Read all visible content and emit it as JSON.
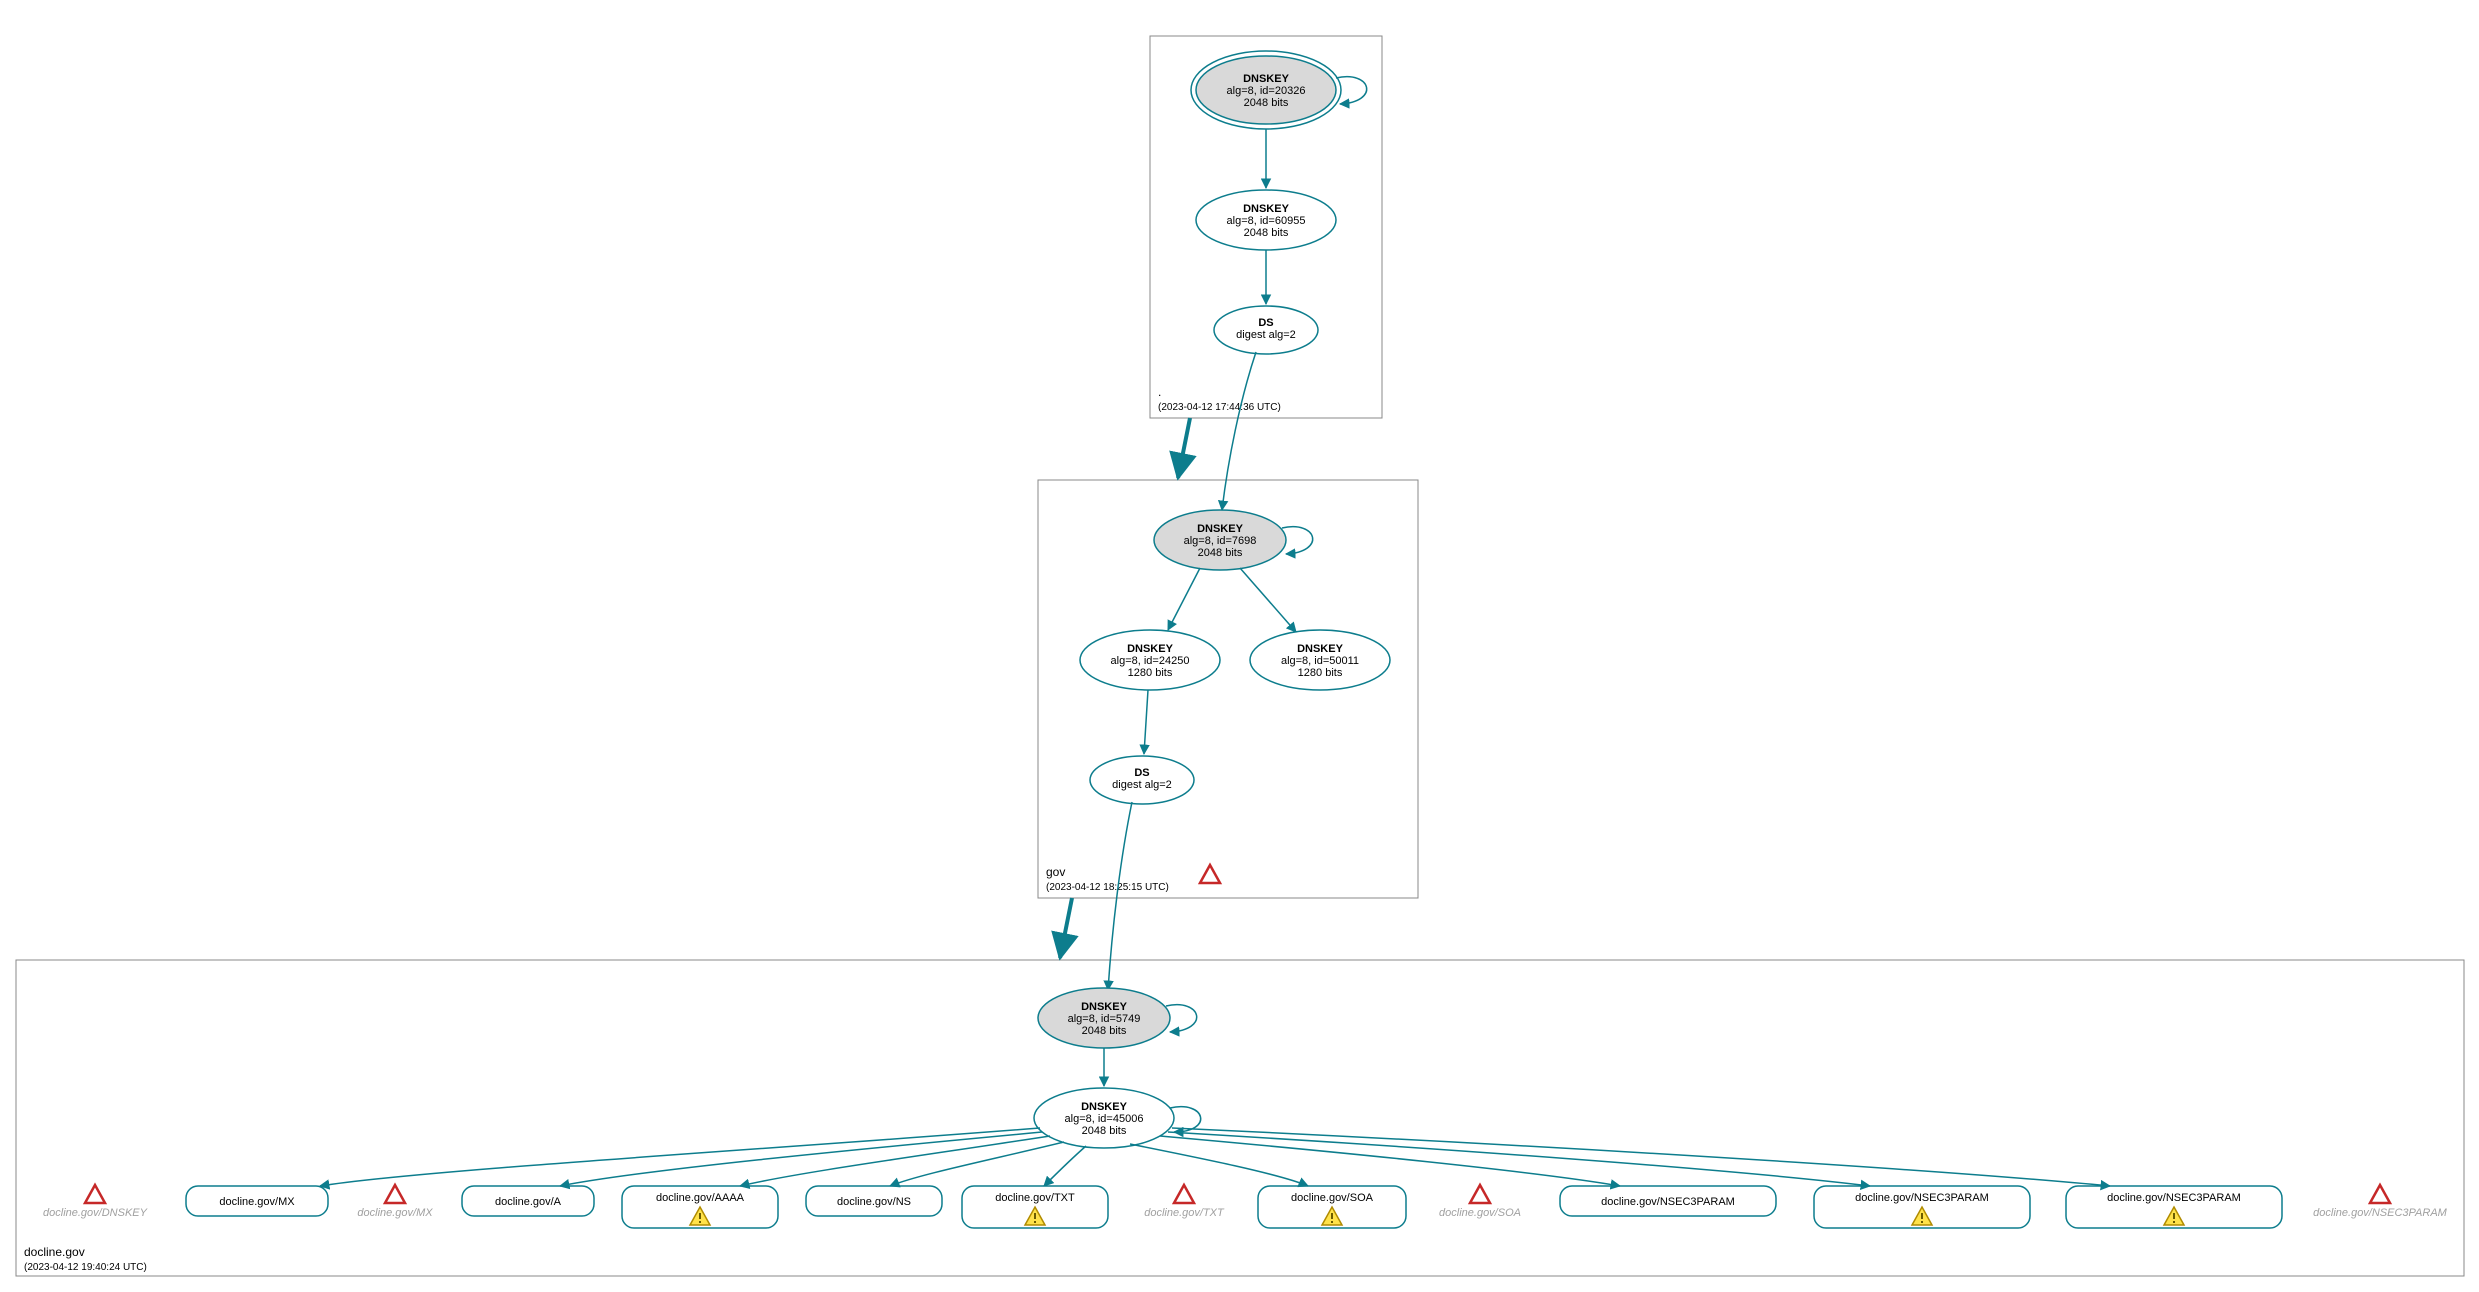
{
  "zones": {
    "root": {
      "name": ".",
      "ts": "(2023-04-12 17:44:36 UTC)"
    },
    "gov": {
      "name": "gov",
      "ts": "(2023-04-12 18:25:15 UTC)"
    },
    "docline": {
      "name": "docline.gov",
      "ts": "(2023-04-12 19:40:24 UTC)"
    }
  },
  "keys": {
    "rootKSK": {
      "t": "DNSKEY",
      "l2": "alg=8, id=20326",
      "l3": "2048 bits"
    },
    "rootZSK": {
      "t": "DNSKEY",
      "l2": "alg=8, id=60955",
      "l3": "2048 bits"
    },
    "rootDS": {
      "t": "DS",
      "l2": "digest alg=2"
    },
    "govKSK": {
      "t": "DNSKEY",
      "l2": "alg=8, id=7698",
      "l3": "2048 bits"
    },
    "govZSK1": {
      "t": "DNSKEY",
      "l2": "alg=8, id=24250",
      "l3": "1280 bits"
    },
    "govZSK2": {
      "t": "DNSKEY",
      "l2": "alg=8, id=50011",
      "l3": "1280 bits"
    },
    "govDS": {
      "t": "DS",
      "l2": "digest alg=2"
    },
    "dlKSK": {
      "t": "DNSKEY",
      "l2": "alg=8, id=5749",
      "l3": "2048 bits"
    },
    "dlZSK": {
      "t": "DNSKEY",
      "l2": "alg=8, id=45006",
      "l3": "2048 bits"
    }
  },
  "rr": {
    "mx": "docline.gov/MX",
    "a": "docline.gov/A",
    "aaaa": "docline.gov/AAAA",
    "ns": "docline.gov/NS",
    "txt": "docline.gov/TXT",
    "soa": "docline.gov/SOA",
    "n3p1": "docline.gov/NSEC3PARAM",
    "n3p2": "docline.gov/NSEC3PARAM",
    "n3p3": "docline.gov/NSEC3PARAM"
  },
  "ghosts": {
    "dnskey": "docline.gov/DNSKEY",
    "mx": "docline.gov/MX",
    "txt": "docline.gov/TXT",
    "soa": "docline.gov/SOA",
    "n3p": "docline.gov/NSEC3PARAM"
  }
}
